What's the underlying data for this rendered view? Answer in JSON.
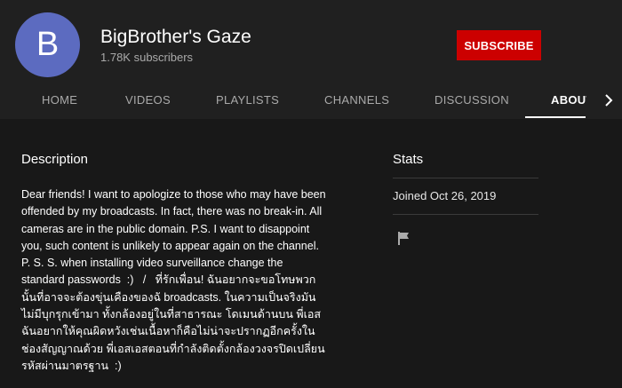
{
  "channel": {
    "avatar_letter": "B",
    "avatar_color": "#5c6bc0",
    "name": "BigBrother's Gaze",
    "subscribers": "1.78K subscribers",
    "subscribe_label": "SUBSCRIBE",
    "subscribe_color": "#cc0000"
  },
  "tabs": [
    {
      "label": "HOME"
    },
    {
      "label": "VIDEOS"
    },
    {
      "label": "PLAYLISTS"
    },
    {
      "label": "CHANNELS"
    },
    {
      "label": "DISCUSSION"
    },
    {
      "label": "ABOUT",
      "active": true
    }
  ],
  "tabs_more_icon": "chevron-right-icon",
  "about": {
    "description_title": "Description",
    "description": "Dear friends! I want to apologize to those who may have been offended by my broadcasts. In fact, there was no break-in. All cameras are in the public domain. P.S. I want to disappoint you, such content is unlikely to appear again on the channel. P. S. S. when installing video surveillance change the standard passwords  :)   /   ที่รักเพื่อน! ฉันอยากจะขอโทษพวกนั้นที่อาจจะต้องขุ่นเคืองของฉั broadcasts. ในความเป็นจริงมันไม่มีบุกรุกเข้ามา ทั้งกล้องอยู่ในที่สาธารณะ โดเมนด้านบน พี่เอสฉันอยากให้คุณผิดหวังเช่นเนื้อหาก็คือไม่น่าจะปรากฏอีกครั้งในช่องสัญญาณด้วย พี่เอสเอสตอนที่กำลังติดตั้งกล้องวงจรปิดเปลี่ยนรหัสผ่านมาตรฐาน  :)",
    "stats_title": "Stats",
    "joined": "Joined Oct 26, 2019",
    "report_icon": "flag-icon"
  }
}
